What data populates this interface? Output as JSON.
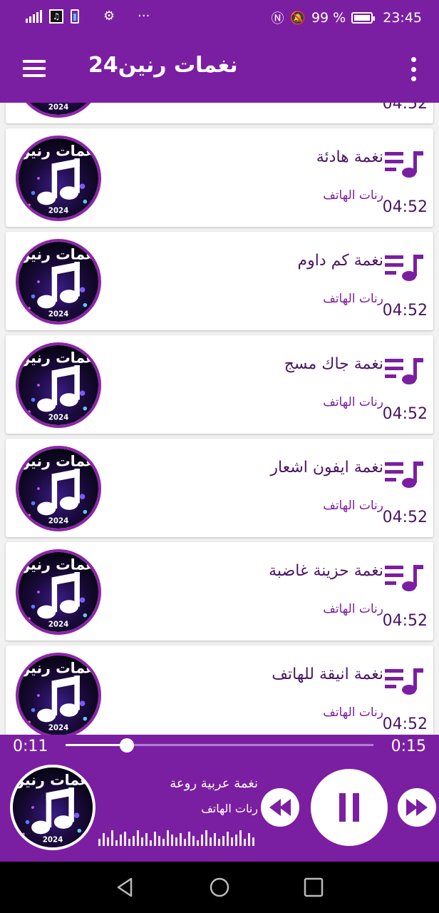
{
  "status_bar": {
    "battery_percent": "99 %",
    "time": "23:45",
    "icons": [
      "signal-icon",
      "sim-icon",
      "battery-saver-icon",
      "settings-icon",
      "more-notifications-icon",
      "nfc-icon",
      "mute-icon",
      "battery-icon"
    ]
  },
  "app_bar": {
    "title": "نغمات رنين24"
  },
  "thumbnail": {
    "label": "نغمات رنين",
    "year": "2024"
  },
  "songs": [
    {
      "title": "",
      "artist": "",
      "duration": "04:52"
    },
    {
      "title": "نغمة هادئة",
      "artist": "رنات الهاتف",
      "duration": "04:52"
    },
    {
      "title": "نغمة كم داوم",
      "artist": "رنات الهاتف",
      "duration": "04:52"
    },
    {
      "title": "نغمة جاك مسج",
      "artist": "رنات الهاتف",
      "duration": "04:52"
    },
    {
      "title": "نغمة ايفون اشعار",
      "artist": "رنات الهاتف",
      "duration": "04:52"
    },
    {
      "title": "نغمة حزينة غاضبة",
      "artist": "رنات الهاتف",
      "duration": "04:52"
    },
    {
      "title": "نغمة انيقة للهاتف",
      "artist": "رنات الهاتف",
      "duration": "04:52"
    }
  ],
  "player": {
    "current_time": "0:11",
    "total_time": "0:15",
    "progress": 0.2,
    "now_playing_title": "نغمة عربية روعة",
    "now_playing_artist": "رنات الهاتف"
  },
  "colors": {
    "primary": "#7b1fa2",
    "accent": "#8e24aa",
    "text": "#4a1566"
  }
}
